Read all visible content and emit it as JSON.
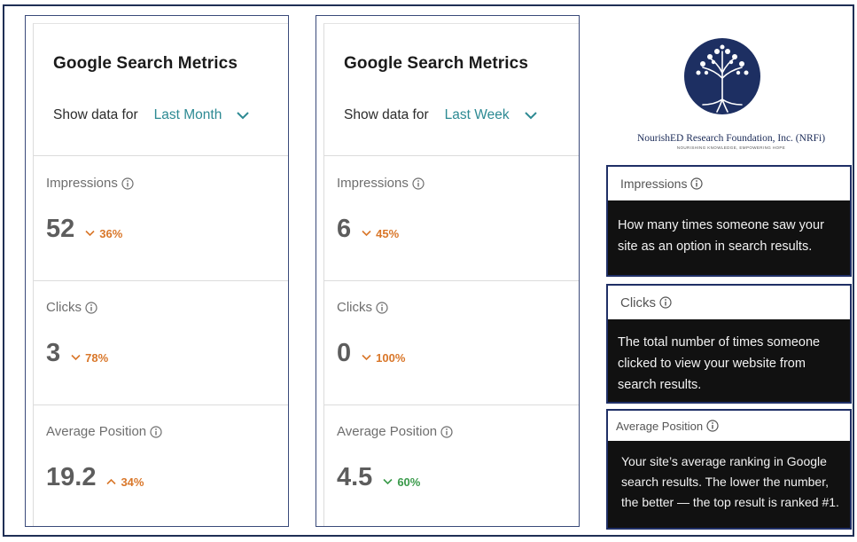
{
  "panels": [
    {
      "title": "Google Search Metrics",
      "show_label": "Show data for",
      "period": "Last Month",
      "metrics": [
        {
          "label": "Impressions",
          "value": "52",
          "delta": "36%",
          "direction": "down"
        },
        {
          "label": "Clicks",
          "value": "3",
          "delta": "78%",
          "direction": "down"
        },
        {
          "label": "Average Position",
          "value": "19.2",
          "delta": "34%",
          "direction": "up"
        }
      ]
    },
    {
      "title": "Google Search Metrics",
      "show_label": "Show data for",
      "period": "Last Week",
      "metrics": [
        {
          "label": "Impressions",
          "value": "6",
          "delta": "45%",
          "direction": "down"
        },
        {
          "label": "Clicks",
          "value": "0",
          "delta": "100%",
          "direction": "down"
        },
        {
          "label": "Average Position",
          "value": "4.5",
          "delta": "60%",
          "direction": "down"
        }
      ]
    }
  ],
  "org": {
    "name": "NourishED Research Foundation, Inc. (NRFi)",
    "tagline": "NOURISHING KNOWLEDGE, EMPOWERING HOPE",
    "logo_icon": "tree-logo-icon"
  },
  "definitions": [
    {
      "label": "Impressions",
      "text": "How many times someone saw your site as an option in search results."
    },
    {
      "label": "Clicks",
      "text": "The total number of times someone clicked to view your website from search results."
    },
    {
      "label": "Average Position",
      "text": "Your site’s average ranking in Google search results. The lower the number, the better — the top result is ranked #1."
    }
  ],
  "colors": {
    "period_link": "#2d8a93",
    "delta_down": "#d9772a",
    "delta_good": "#3a9a4a",
    "border_navy": "#1f2f55",
    "definition_bg": "#111111"
  }
}
